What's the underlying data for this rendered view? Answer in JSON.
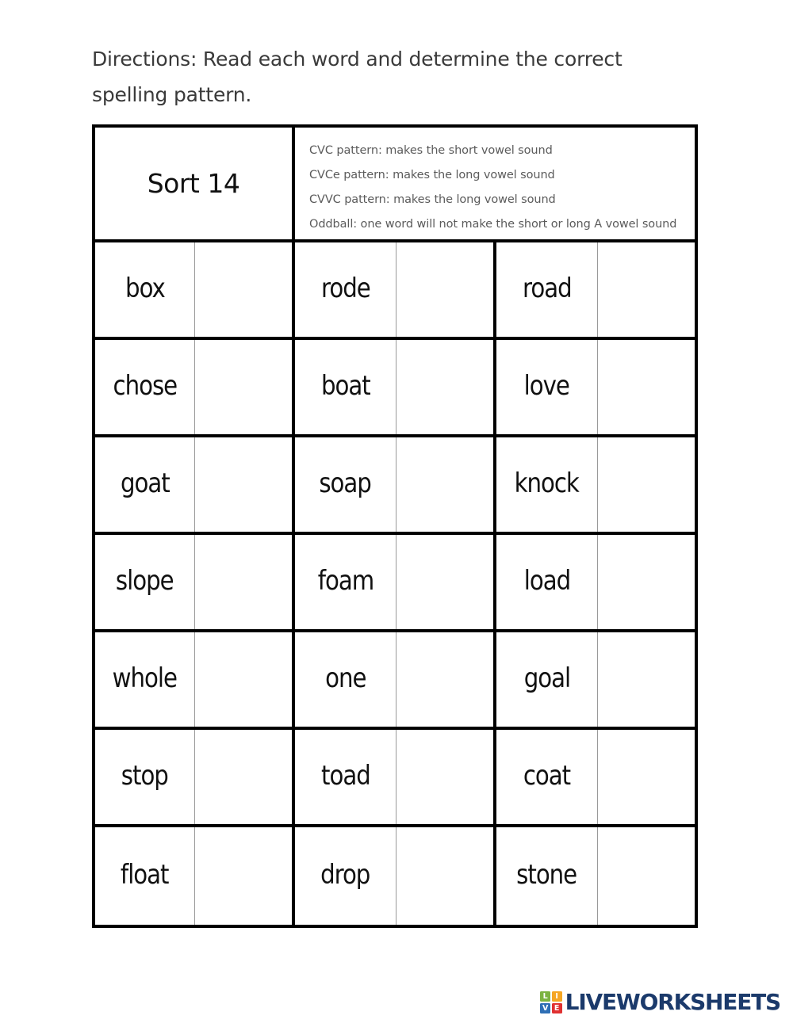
{
  "directions": "Directions: Read each word and determine the correct spelling pattern.",
  "table": {
    "sort_title": "Sort 14",
    "legend": [
      "CVC pattern: makes the short vowel sound",
      "CVCe pattern: makes the long vowel sound",
      "CVVC pattern: makes the long vowel sound",
      "Oddball: one word will not make the short or long A vowel sound"
    ],
    "rows": [
      [
        "box",
        "rode",
        "road"
      ],
      [
        "chose",
        "boat",
        "love"
      ],
      [
        "goat",
        "soap",
        "knock"
      ],
      [
        "slope",
        "foam",
        "load"
      ],
      [
        "whole",
        "one",
        "goal"
      ],
      [
        "stop",
        "toad",
        "coat"
      ],
      [
        "float",
        "drop",
        "stone"
      ]
    ],
    "answers": [
      [
        "",
        "",
        ""
      ],
      [
        "",
        "",
        ""
      ],
      [
        "",
        "",
        ""
      ],
      [
        "",
        "",
        ""
      ],
      [
        "",
        "",
        ""
      ],
      [
        "",
        "",
        ""
      ],
      [
        "",
        "",
        ""
      ]
    ]
  },
  "footer": {
    "logo_tiles": [
      "L",
      "I",
      "V",
      "E"
    ],
    "logo_text": "LIVEWORKSHEETS"
  },
  "colors": {
    "border": "#000000",
    "thin_border": "#9a9a9a",
    "text": "#111111",
    "legend_text": "#5b5b5b",
    "directions_text": "#3a3a3a",
    "logo_navy": "#1b3a6b",
    "tile_green": "#7cb342",
    "tile_orange": "#f5a623",
    "tile_blue": "#2f6fb5",
    "tile_red": "#e03131"
  }
}
